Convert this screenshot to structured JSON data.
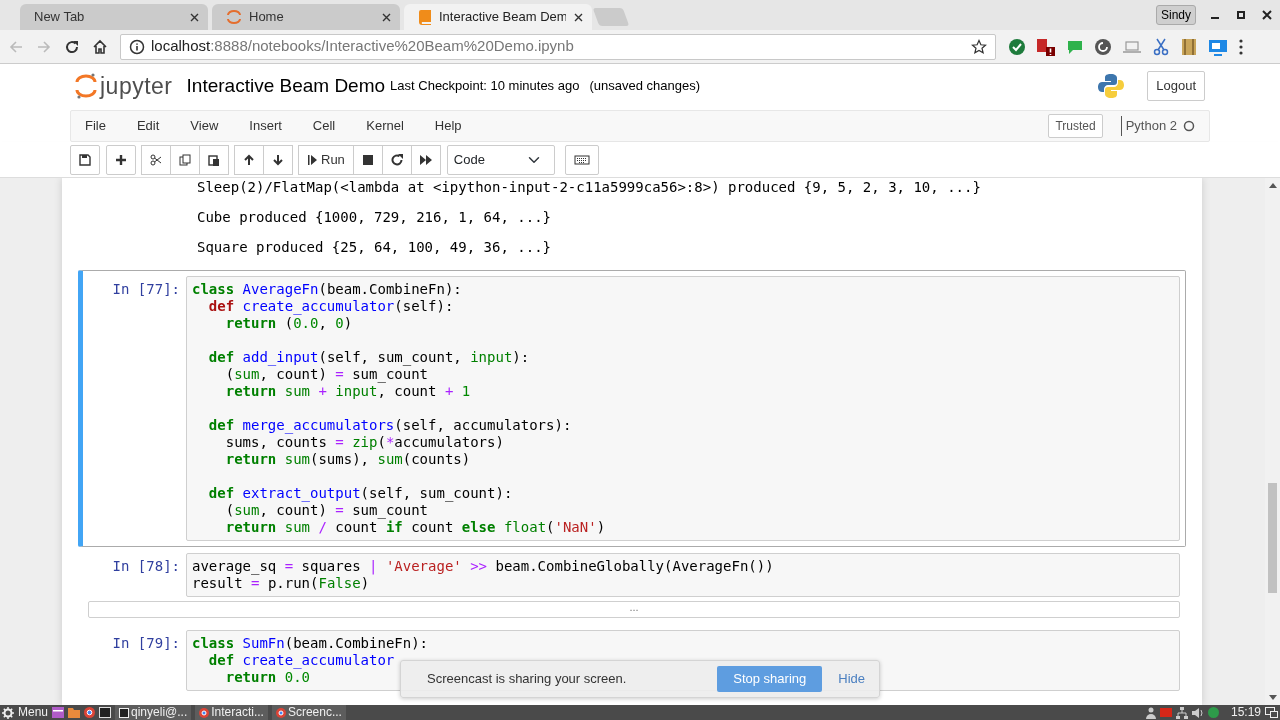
{
  "browser": {
    "tabs": [
      {
        "label": "New Tab",
        "selected": false
      },
      {
        "label": "Home",
        "selected": false
      },
      {
        "label": "Interactive Beam Dem",
        "selected": true
      }
    ],
    "profile": "Sindy",
    "back_disabled": true,
    "forward_disabled": true,
    "url_host": "localhost",
    "url_rest": ":8888/notebooks/Interactive%20Beam%20Demo.ipynb"
  },
  "notebook": {
    "logo_text": "jupyter",
    "title": "Interactive Beam Demo",
    "checkpoint": "Last Checkpoint: 10 minutes ago",
    "save_status": "(unsaved changes)",
    "logout": "Logout",
    "menu": [
      "File",
      "Edit",
      "View",
      "Insert",
      "Cell",
      "Kernel",
      "Help"
    ],
    "trusted": "Trusted",
    "kernel": "Python 2",
    "run_label": "Run",
    "cell_type": "Code"
  },
  "cells": [
    {
      "kind": "output",
      "lines": [
        "Sleep(2)/FlatMap(<lambda at <ipython-input-2-c11a5999ca56>:8>) produced {9, 5, 2, 3, 10, ...}",
        "Cube produced {1000, 729, 216, 1, 64, ...}",
        "Square produced {25, 64, 100, 49, 36, ...}"
      ]
    },
    {
      "kind": "code",
      "prompt": "In [77]:",
      "selected": true,
      "lines": [
        {
          "tokens": [
            {
              "kind": "kw",
              "text": "class"
            },
            {
              "kind": "def",
              "text": " AverageFn"
            },
            {
              "kind": "p",
              "text": "(beam.CombineFn):"
            }
          ]
        },
        {
          "tokens": [
            {
              "kind": "kwhl",
              "text": "  def"
            },
            {
              "kind": "def",
              "text": " create_accumulator"
            },
            {
              "kind": "p",
              "text": "(self):"
            }
          ]
        },
        {
          "tokens": [
            {
              "kind": "kw",
              "text": "    return"
            },
            {
              "kind": "p",
              "text": " ("
            },
            {
              "kind": "num",
              "text": "0.0"
            },
            {
              "kind": "p",
              "text": ", "
            },
            {
              "kind": "num",
              "text": "0"
            },
            {
              "kind": "p",
              "text": ")"
            }
          ]
        },
        {
          "blank_before": true,
          "tokens": [
            {
              "kind": "kw",
              "text": "  def"
            },
            {
              "kind": "def",
              "text": " add_input"
            },
            {
              "kind": "p",
              "text": "(self, sum_count, "
            },
            {
              "kind": "bi",
              "text": "input"
            },
            {
              "kind": "p",
              "text": "):"
            }
          ]
        },
        {
          "tokens": [
            {
              "kind": "p",
              "text": "    ("
            },
            {
              "kind": "bi",
              "text": "sum"
            },
            {
              "kind": "p",
              "text": ", count) "
            },
            {
              "kind": "op",
              "text": "="
            },
            {
              "kind": "p",
              "text": " sum_count"
            }
          ]
        },
        {
          "tokens": [
            {
              "kind": "kw",
              "text": "    return"
            },
            {
              "kind": "bi",
              "text": " sum"
            },
            {
              "kind": "op",
              "text": " +"
            },
            {
              "kind": "bi",
              "text": " input"
            },
            {
              "kind": "p",
              "text": ", count "
            },
            {
              "kind": "op",
              "text": "+"
            },
            {
              "kind": "num",
              "text": " 1"
            }
          ]
        },
        {
          "blank_before": true,
          "tokens": [
            {
              "kind": "kw",
              "text": "  def"
            },
            {
              "kind": "def",
              "text": " merge_accumulators"
            },
            {
              "kind": "p",
              "text": "(self, accumulators):"
            }
          ]
        },
        {
          "tokens": [
            {
              "kind": "p",
              "text": "    sums, counts "
            },
            {
              "kind": "op",
              "text": "="
            },
            {
              "kind": "bi",
              "text": " zip"
            },
            {
              "kind": "p",
              "text": "("
            },
            {
              "kind": "op",
              "text": "*"
            },
            {
              "kind": "p",
              "text": "accumulators)"
            }
          ]
        },
        {
          "tokens": [
            {
              "kind": "kw",
              "text": "    return"
            },
            {
              "kind": "bi",
              "text": " sum"
            },
            {
              "kind": "p",
              "text": "(sums), "
            },
            {
              "kind": "bi",
              "text": "sum"
            },
            {
              "kind": "p",
              "text": "(counts)"
            }
          ]
        },
        {
          "blank_before": true,
          "tokens": [
            {
              "kind": "kw",
              "text": "  def"
            },
            {
              "kind": "def",
              "text": " extract_output"
            },
            {
              "kind": "p",
              "text": "(self, sum_count):"
            }
          ]
        },
        {
          "tokens": [
            {
              "kind": "p",
              "text": "    ("
            },
            {
              "kind": "bi",
              "text": "sum"
            },
            {
              "kind": "p",
              "text": ", count) "
            },
            {
              "kind": "op",
              "text": "="
            },
            {
              "kind": "p",
              "text": " sum_count"
            }
          ]
        },
        {
          "tokens": [
            {
              "kind": "kw",
              "text": "    return"
            },
            {
              "kind": "bi",
              "text": " sum"
            },
            {
              "kind": "op",
              "text": " /"
            },
            {
              "kind": "p",
              "text": " count "
            },
            {
              "kind": "kw",
              "text": "if"
            },
            {
              "kind": "p",
              "text": " count "
            },
            {
              "kind": "kw",
              "text": "else"
            },
            {
              "kind": "bi",
              "text": " float"
            },
            {
              "kind": "p",
              "text": "("
            },
            {
              "kind": "str",
              "text": "'NaN'"
            },
            {
              "kind": "p",
              "text": ")"
            }
          ]
        }
      ]
    },
    {
      "kind": "code",
      "prompt": "In [78]:",
      "selected": false,
      "collapsed_output": "...",
      "lines": [
        {
          "tokens": [
            {
              "kind": "p",
              "text": "average_sq "
            },
            {
              "kind": "op",
              "text": "="
            },
            {
              "kind": "p",
              "text": " squares "
            },
            {
              "kind": "op",
              "text": "|"
            },
            {
              "kind": "str",
              "text": " 'Average'"
            },
            {
              "kind": "op",
              "text": " >>"
            },
            {
              "kind": "p",
              "text": " beam.CombineGlobally(AverageFn())"
            }
          ]
        },
        {
          "tokens": [
            {
              "kind": "p",
              "text": "result "
            },
            {
              "kind": "op",
              "text": "="
            },
            {
              "kind": "p",
              "text": " p.run("
            },
            {
              "kind": "bi",
              "text": "False"
            },
            {
              "kind": "p",
              "text": ")"
            }
          ]
        }
      ]
    },
    {
      "kind": "code",
      "prompt": "In [79]:",
      "selected": false,
      "lines": [
        {
          "tokens": [
            {
              "kind": "kw",
              "text": "class"
            },
            {
              "kind": "def",
              "text": " SumFn"
            },
            {
              "kind": "p",
              "text": "(beam.CombineFn):"
            }
          ]
        },
        {
          "tokens": [
            {
              "kind": "kw",
              "text": "  def"
            },
            {
              "kind": "def",
              "text": " create_accumulator"
            }
          ]
        },
        {
          "tokens": [
            {
              "kind": "kw",
              "text": "    return"
            },
            {
              "kind": "num",
              "text": " 0.0"
            }
          ]
        }
      ]
    }
  ],
  "notification": {
    "message": "Screencast is sharing your screen.",
    "primary": "Stop sharing",
    "secondary": "Hide"
  },
  "taskbar": {
    "menu": "Menu",
    "windows": [
      "qinyeli@...",
      "Interacti...",
      "Screenc..."
    ],
    "clock": "15:19"
  }
}
